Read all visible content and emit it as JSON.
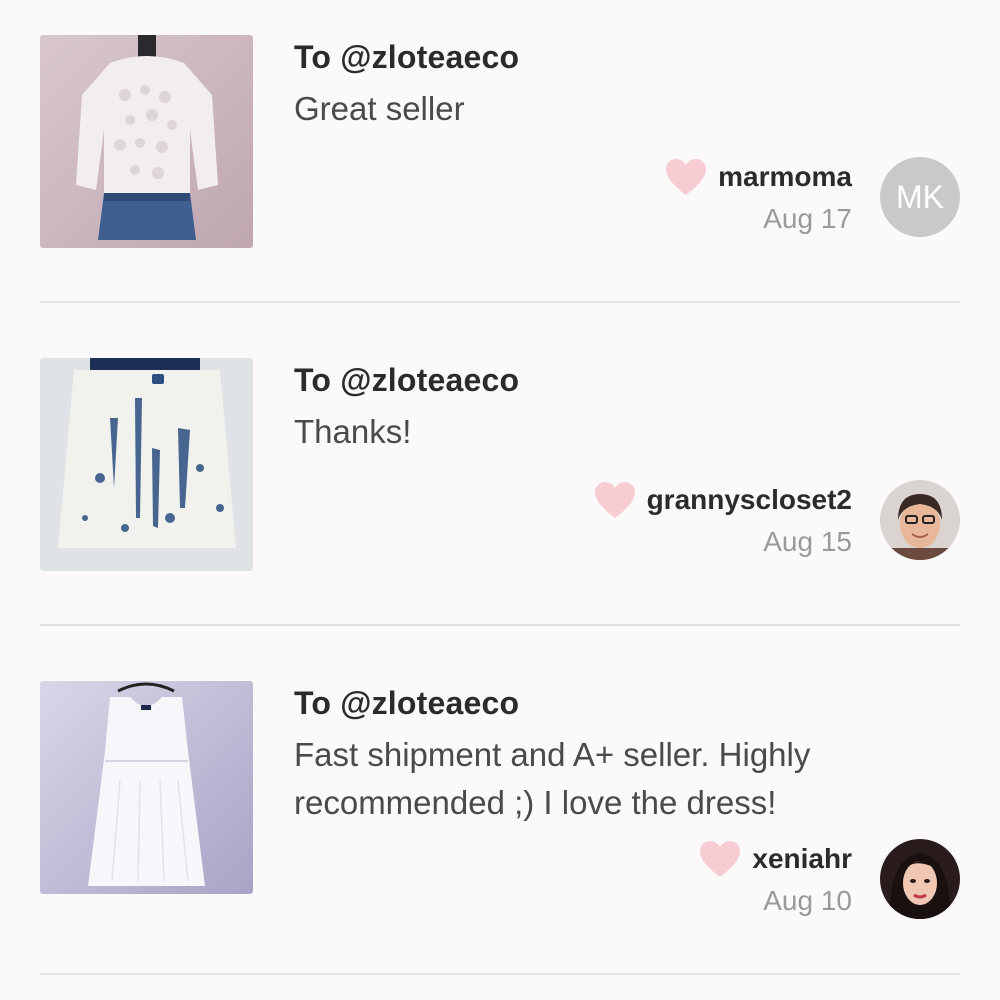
{
  "reviews": [
    {
      "recipient": "To @zloteaeco",
      "message": "Great seller",
      "username": "marmoma",
      "date": "Aug 17",
      "avatar_initials": "MK",
      "item": "lace top and denim skirt listing photo"
    },
    {
      "recipient": "To @zloteaeco",
      "message": "Thanks!",
      "username": "grannyscloset2",
      "date": "Aug 15",
      "avatar_initials": "",
      "item": "bleached denim skirt listing photo"
    },
    {
      "recipient": "To @zloteaeco",
      "message": "Fast shipment and A+ seller. Highly recommended ;) I love the dress!",
      "username": "xeniahr",
      "date": "Aug 10",
      "avatar_initials": "",
      "item": "white sleeveless dress listing photo"
    }
  ],
  "colors": {
    "background": "#fbf9fa",
    "heart": "#f7cdd3",
    "divider": "#e1e1e1",
    "initials_avatar": "#c9c9c9"
  },
  "icons": {
    "like": "heart-icon"
  }
}
